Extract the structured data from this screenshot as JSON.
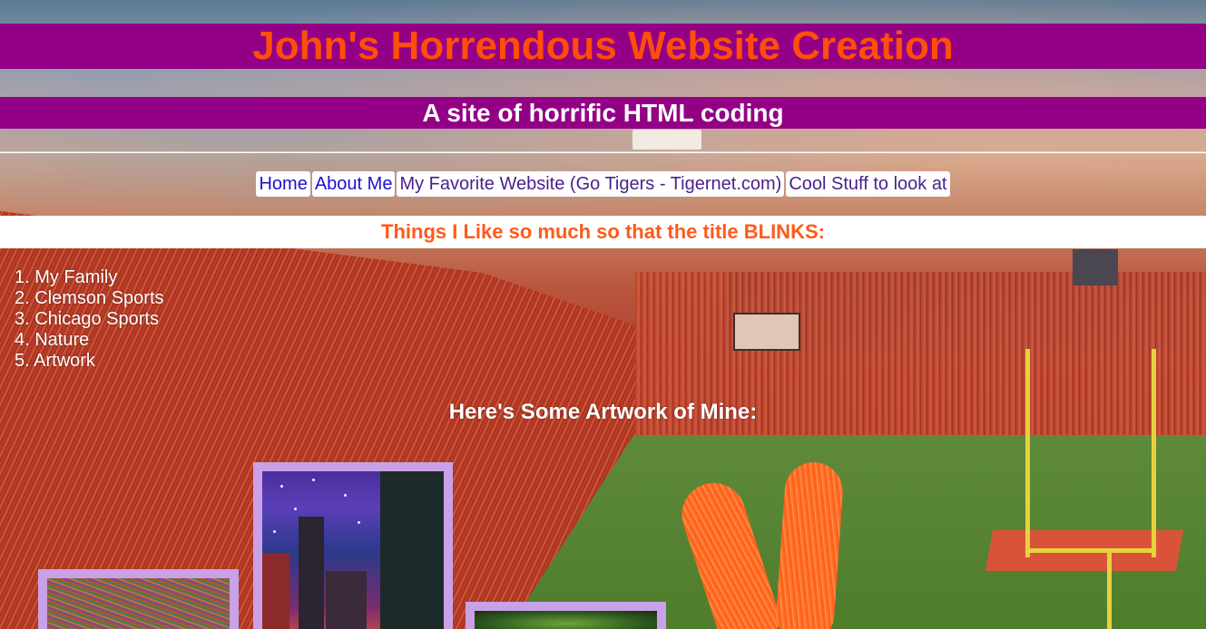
{
  "header": {
    "title": "John's Horrendous Website Creation",
    "subtitle": "A site of horrific HTML coding"
  },
  "nav": {
    "links": [
      {
        "label": "Home"
      },
      {
        "label": "About Me"
      },
      {
        "label": "My Favorite Website (Go Tigers - Tigernet.com)"
      },
      {
        "label": "Cool Stuff to look at"
      }
    ]
  },
  "likes": {
    "heading": "Things I Like so much so that the title BLINKS:",
    "items": [
      "1. My Family",
      "2. Clemson Sports",
      "3. Chicago Sports",
      "4. Nature",
      "5. Artwork"
    ]
  },
  "artwork": {
    "heading": "Here's Some Artwork of Mine:"
  },
  "colors": {
    "banner": "#930085",
    "title_text": "#ff4e0a",
    "blink_text": "#ff5a1a",
    "frame": "#c9a1e6"
  }
}
